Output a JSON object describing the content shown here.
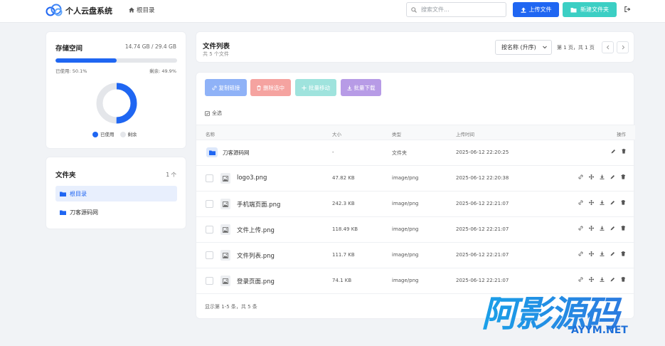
{
  "header": {
    "brand": "个人云盘系统",
    "nav_root": "根目录",
    "search_placeholder": "搜索文件...",
    "upload_label": "上传文件",
    "new_folder_label": "新建文件夹"
  },
  "storage": {
    "title": "存储空间",
    "usage_text": "14.74 GB / 29.4 GB",
    "used_label": "已使用: 50.1%",
    "free_label": "剩余: 49.9%",
    "used_fraction": 0.501,
    "legend_used": "已使用",
    "legend_free": "剩余",
    "colors": {
      "used": "#1f66f2",
      "free": "#e4e6ea"
    }
  },
  "folders": {
    "title": "文件夹",
    "count": "1 个",
    "items": [
      {
        "label": "根目录",
        "active": true
      },
      {
        "label": "刀客源码网",
        "active": false
      }
    ]
  },
  "list": {
    "title": "文件列表",
    "subtitle": "共 5 个文件",
    "sort_value": "按名称 (升序)",
    "page_info": "第 1 页，共 1 页",
    "toolbar": {
      "copy_link": "复制链接",
      "delete_selected": "删除选中",
      "batch_move": "批量移动",
      "batch_download": "批量下载"
    },
    "select_all": "全选",
    "columns": {
      "name": "名称",
      "size": "大小",
      "type": "类型",
      "time": "上传时间",
      "ops": "操作"
    },
    "rows": [
      {
        "name": "刀客源码网",
        "size": "-",
        "type": "文件夹",
        "time": "2025-06-12 22:20:25",
        "kind": "folder"
      },
      {
        "name": "logo3.png",
        "size": "47.82 KB",
        "type": "image/png",
        "time": "2025-06-12 22:20:38",
        "kind": "file"
      },
      {
        "name": "手机端页面.png",
        "size": "242.3 KB",
        "type": "image/png",
        "time": "2025-06-12 22:21:07",
        "kind": "file"
      },
      {
        "name": "文件上传.png",
        "size": "118.49 KB",
        "type": "image/png",
        "time": "2025-06-12 22:21:07",
        "kind": "file"
      },
      {
        "name": "文件列表.png",
        "size": "111.7 KB",
        "type": "image/png",
        "time": "2025-06-12 22:21:07",
        "kind": "file"
      },
      {
        "name": "登录页面.png",
        "size": "74.1 KB",
        "type": "image/png",
        "time": "2025-06-12 22:21:07",
        "kind": "file"
      }
    ],
    "footer": "显示第 1-5 条，共 5 条"
  },
  "watermark": {
    "text": "阿影源码",
    "domain": "AYYM.NET"
  }
}
